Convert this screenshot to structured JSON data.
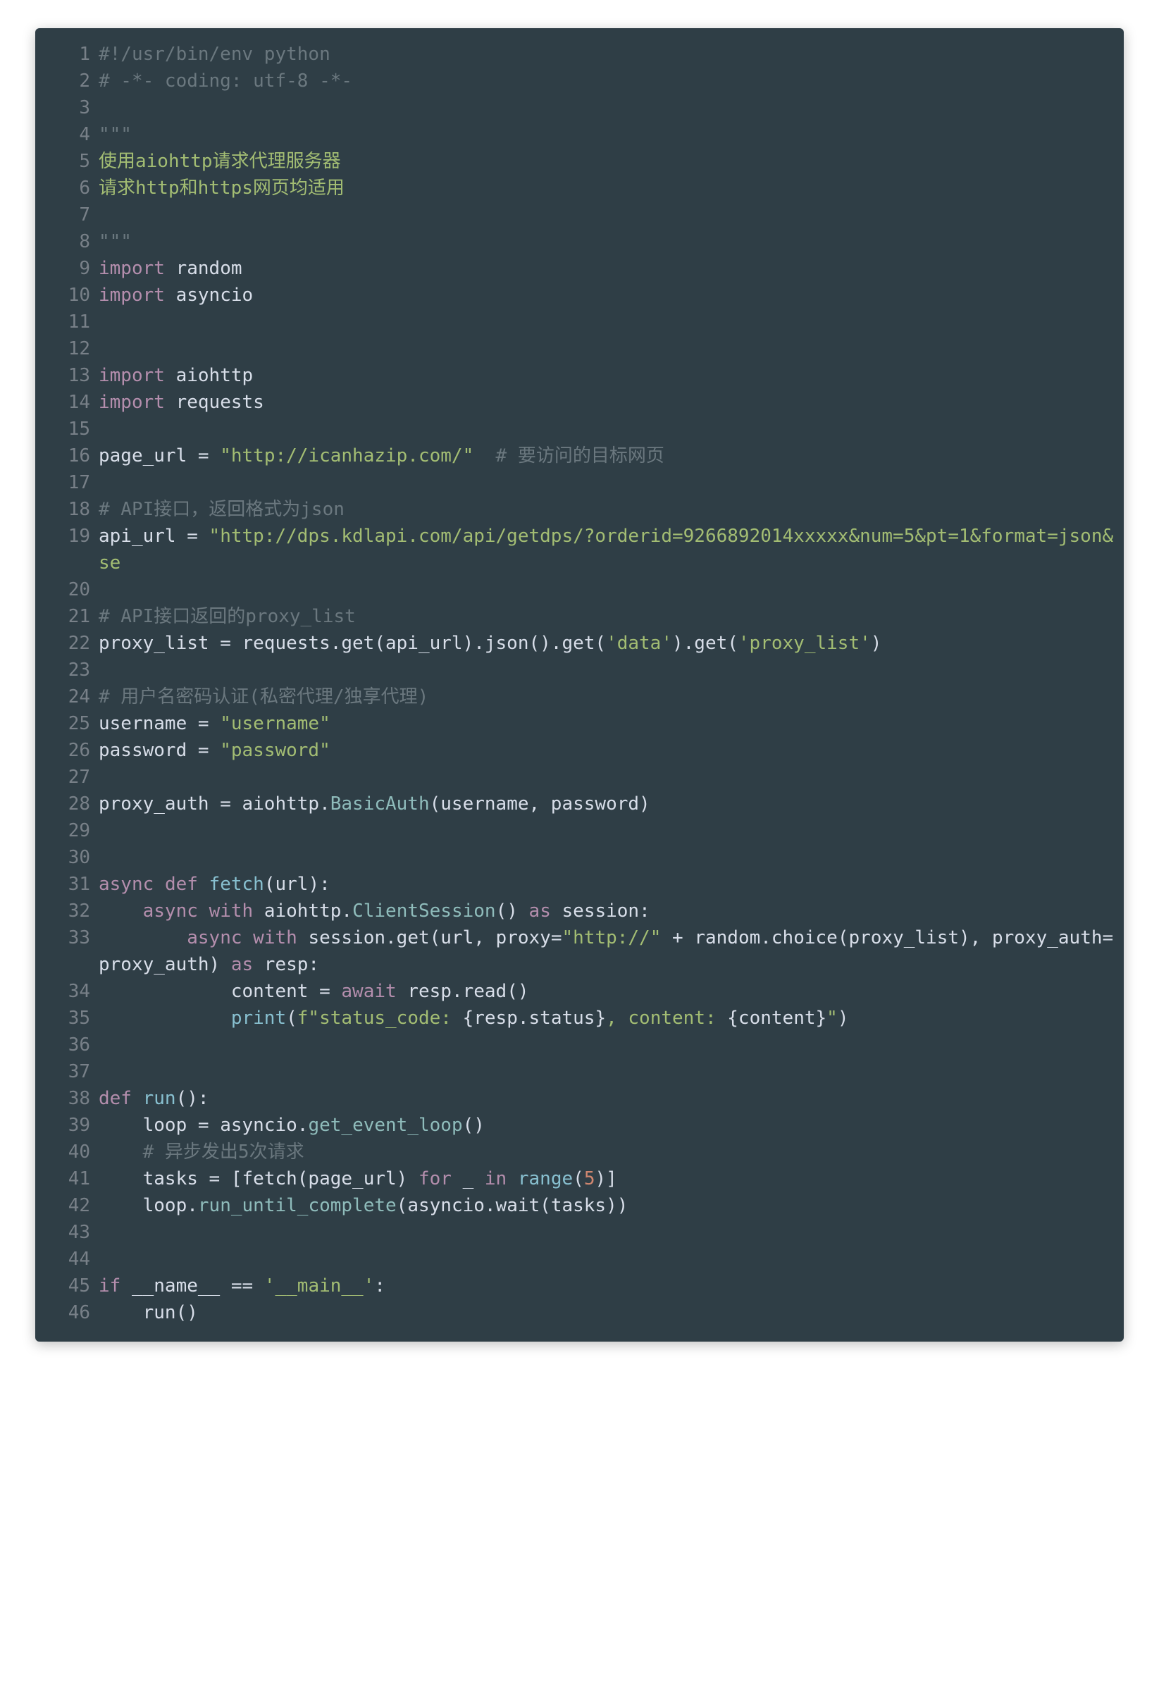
{
  "lines": [
    {
      "n": 1,
      "tokens": [
        {
          "c": "tk-comment",
          "t": "#!/usr/bin/env python"
        }
      ]
    },
    {
      "n": 2,
      "tokens": [
        {
          "c": "tk-comment",
          "t": "# -*- coding: utf-8 -*-"
        }
      ]
    },
    {
      "n": 3,
      "tokens": [
        {
          "c": "tk-plain",
          "t": ""
        }
      ]
    },
    {
      "n": 4,
      "tokens": [
        {
          "c": "tk-docstr",
          "t": "\"\"\""
        }
      ]
    },
    {
      "n": 5,
      "tokens": [
        {
          "c": "tk-doccn",
          "t": "使用aiohttp请求代理服务器"
        }
      ]
    },
    {
      "n": 6,
      "tokens": [
        {
          "c": "tk-doccn",
          "t": "请求http和https网页均适用"
        }
      ]
    },
    {
      "n": 7,
      "tokens": [
        {
          "c": "tk-plain",
          "t": ""
        }
      ]
    },
    {
      "n": 8,
      "tokens": [
        {
          "c": "tk-docstr",
          "t": "\"\"\""
        }
      ]
    },
    {
      "n": 9,
      "tokens": [
        {
          "c": "tk-keyword",
          "t": "import"
        },
        {
          "c": "tk-plain",
          "t": " random"
        }
      ]
    },
    {
      "n": 10,
      "tokens": [
        {
          "c": "tk-keyword",
          "t": "import"
        },
        {
          "c": "tk-plain",
          "t": " asyncio"
        }
      ]
    },
    {
      "n": 11,
      "tokens": [
        {
          "c": "tk-plain",
          "t": ""
        }
      ]
    },
    {
      "n": 12,
      "tokens": [
        {
          "c": "tk-plain",
          "t": ""
        }
      ]
    },
    {
      "n": 13,
      "tokens": [
        {
          "c": "tk-keyword",
          "t": "import"
        },
        {
          "c": "tk-plain",
          "t": " aiohttp"
        }
      ]
    },
    {
      "n": 14,
      "tokens": [
        {
          "c": "tk-keyword",
          "t": "import"
        },
        {
          "c": "tk-plain",
          "t": " requests"
        }
      ]
    },
    {
      "n": 15,
      "tokens": [
        {
          "c": "tk-plain",
          "t": ""
        }
      ]
    },
    {
      "n": 16,
      "tokens": [
        {
          "c": "tk-plain",
          "t": "page_url "
        },
        {
          "c": "tk-op",
          "t": "="
        },
        {
          "c": "tk-plain",
          "t": " "
        },
        {
          "c": "tk-string",
          "t": "\"http://icanhazip.com/\""
        },
        {
          "c": "tk-plain",
          "t": "  "
        },
        {
          "c": "tk-comment",
          "t": "# 要访问的目标网页"
        }
      ]
    },
    {
      "n": 17,
      "tokens": [
        {
          "c": "tk-plain",
          "t": ""
        }
      ]
    },
    {
      "n": 18,
      "tokens": [
        {
          "c": "tk-comment",
          "t": "# API接口，返回格式为json"
        }
      ]
    },
    {
      "n": 19,
      "tokens": [
        {
          "c": "tk-plain",
          "t": "api_url "
        },
        {
          "c": "tk-op",
          "t": "="
        },
        {
          "c": "tk-plain",
          "t": " "
        },
        {
          "c": "tk-string",
          "t": "\"http://dps.kdlapi.com/api/getdps/?orderid=9266892014xxxxx&num=5&pt=1&format=json&se"
        }
      ]
    },
    {
      "n": 20,
      "tokens": [
        {
          "c": "tk-plain",
          "t": ""
        }
      ]
    },
    {
      "n": 21,
      "tokens": [
        {
          "c": "tk-comment",
          "t": "# API接口返回的proxy_list"
        }
      ]
    },
    {
      "n": 22,
      "tokens": [
        {
          "c": "tk-plain",
          "t": "proxy_list "
        },
        {
          "c": "tk-op",
          "t": "="
        },
        {
          "c": "tk-plain",
          "t": " requests.get(api_url).json().get("
        },
        {
          "c": "tk-string",
          "t": "'data'"
        },
        {
          "c": "tk-plain",
          "t": ").get("
        },
        {
          "c": "tk-string",
          "t": "'proxy_list'"
        },
        {
          "c": "tk-plain",
          "t": ")"
        }
      ]
    },
    {
      "n": 23,
      "tokens": [
        {
          "c": "tk-plain",
          "t": ""
        }
      ]
    },
    {
      "n": 24,
      "tokens": [
        {
          "c": "tk-comment",
          "t": "# 用户名密码认证(私密代理/独享代理)"
        }
      ]
    },
    {
      "n": 25,
      "tokens": [
        {
          "c": "tk-plain",
          "t": "username "
        },
        {
          "c": "tk-op",
          "t": "="
        },
        {
          "c": "tk-plain",
          "t": " "
        },
        {
          "c": "tk-string",
          "t": "\"username\""
        }
      ]
    },
    {
      "n": 26,
      "tokens": [
        {
          "c": "tk-plain",
          "t": "password "
        },
        {
          "c": "tk-op",
          "t": "="
        },
        {
          "c": "tk-plain",
          "t": " "
        },
        {
          "c": "tk-string",
          "t": "\"password\""
        }
      ]
    },
    {
      "n": 27,
      "tokens": [
        {
          "c": "tk-plain",
          "t": ""
        }
      ]
    },
    {
      "n": 28,
      "tokens": [
        {
          "c": "tk-plain",
          "t": "proxy_auth "
        },
        {
          "c": "tk-op",
          "t": "="
        },
        {
          "c": "tk-plain",
          "t": " aiohttp."
        },
        {
          "c": "tk-class",
          "t": "BasicAuth"
        },
        {
          "c": "tk-plain",
          "t": "(username, password)"
        }
      ]
    },
    {
      "n": 29,
      "tokens": [
        {
          "c": "tk-plain",
          "t": ""
        }
      ]
    },
    {
      "n": 30,
      "tokens": [
        {
          "c": "tk-plain",
          "t": ""
        }
      ]
    },
    {
      "n": 31,
      "tokens": [
        {
          "c": "tk-keyword",
          "t": "async"
        },
        {
          "c": "tk-plain",
          "t": " "
        },
        {
          "c": "tk-keyword",
          "t": "def"
        },
        {
          "c": "tk-plain",
          "t": " "
        },
        {
          "c": "tk-func",
          "t": "fetch"
        },
        {
          "c": "tk-plain",
          "t": "(url):"
        }
      ]
    },
    {
      "n": 32,
      "tokens": [
        {
          "c": "tk-plain",
          "t": "    "
        },
        {
          "c": "tk-keyword",
          "t": "async"
        },
        {
          "c": "tk-plain",
          "t": " "
        },
        {
          "c": "tk-keyword",
          "t": "with"
        },
        {
          "c": "tk-plain",
          "t": " aiohttp."
        },
        {
          "c": "tk-class",
          "t": "ClientSession"
        },
        {
          "c": "tk-plain",
          "t": "() "
        },
        {
          "c": "tk-keyword",
          "t": "as"
        },
        {
          "c": "tk-plain",
          "t": " session:"
        }
      ]
    },
    {
      "n": 33,
      "tokens": [
        {
          "c": "tk-plain",
          "t": "        "
        },
        {
          "c": "tk-keyword",
          "t": "async"
        },
        {
          "c": "tk-plain",
          "t": " "
        },
        {
          "c": "tk-keyword",
          "t": "with"
        },
        {
          "c": "tk-plain",
          "t": " session.get(url, proxy="
        },
        {
          "c": "tk-string",
          "t": "\"http://\""
        },
        {
          "c": "tk-plain",
          "t": " + random.choice(proxy_list), proxy_auth=proxy_auth) "
        },
        {
          "c": "tk-keyword",
          "t": "as"
        },
        {
          "c": "tk-plain",
          "t": " resp:"
        }
      ]
    },
    {
      "n": 34,
      "tokens": [
        {
          "c": "tk-plain",
          "t": "            content "
        },
        {
          "c": "tk-op",
          "t": "="
        },
        {
          "c": "tk-plain",
          "t": " "
        },
        {
          "c": "tk-await",
          "t": "await"
        },
        {
          "c": "tk-plain",
          "t": " resp.read()"
        }
      ]
    },
    {
      "n": 35,
      "tokens": [
        {
          "c": "tk-plain",
          "t": "            "
        },
        {
          "c": "tk-func",
          "t": "print"
        },
        {
          "c": "tk-plain",
          "t": "("
        },
        {
          "c": "tk-string",
          "t": "f\"status_code: "
        },
        {
          "c": "tk-fstrtxt",
          "t": "{resp.status}"
        },
        {
          "c": "tk-string",
          "t": ", content: "
        },
        {
          "c": "tk-fstrtxt",
          "t": "{content}"
        },
        {
          "c": "tk-string",
          "t": "\""
        },
        {
          "c": "tk-plain",
          "t": ")"
        }
      ]
    },
    {
      "n": 36,
      "tokens": [
        {
          "c": "tk-plain",
          "t": ""
        }
      ]
    },
    {
      "n": 37,
      "tokens": [
        {
          "c": "tk-plain",
          "t": ""
        }
      ]
    },
    {
      "n": 38,
      "tokens": [
        {
          "c": "tk-keyword",
          "t": "def"
        },
        {
          "c": "tk-plain",
          "t": " "
        },
        {
          "c": "tk-func",
          "t": "run"
        },
        {
          "c": "tk-plain",
          "t": "():"
        }
      ]
    },
    {
      "n": 39,
      "tokens": [
        {
          "c": "tk-plain",
          "t": "    loop "
        },
        {
          "c": "tk-op",
          "t": "="
        },
        {
          "c": "tk-plain",
          "t": " asyncio."
        },
        {
          "c": "tk-class",
          "t": "get_event_loop"
        },
        {
          "c": "tk-plain",
          "t": "()"
        }
      ]
    },
    {
      "n": 40,
      "tokens": [
        {
          "c": "tk-plain",
          "t": "    "
        },
        {
          "c": "tk-comment",
          "t": "# 异步发出5次请求"
        }
      ]
    },
    {
      "n": 41,
      "tokens": [
        {
          "c": "tk-plain",
          "t": "    tasks "
        },
        {
          "c": "tk-op",
          "t": "="
        },
        {
          "c": "tk-plain",
          "t": " [fetch(page_url) "
        },
        {
          "c": "tk-keyword",
          "t": "for"
        },
        {
          "c": "tk-plain",
          "t": " _ "
        },
        {
          "c": "tk-keyword",
          "t": "in"
        },
        {
          "c": "tk-plain",
          "t": " "
        },
        {
          "c": "tk-func",
          "t": "range"
        },
        {
          "c": "tk-plain",
          "t": "("
        },
        {
          "c": "tk-number",
          "t": "5"
        },
        {
          "c": "tk-plain",
          "t": ")]"
        }
      ]
    },
    {
      "n": 42,
      "tokens": [
        {
          "c": "tk-plain",
          "t": "    loop."
        },
        {
          "c": "tk-class",
          "t": "run_until_complete"
        },
        {
          "c": "tk-plain",
          "t": "(asyncio.wait(tasks))"
        }
      ]
    },
    {
      "n": 43,
      "tokens": [
        {
          "c": "tk-plain",
          "t": ""
        }
      ]
    },
    {
      "n": 44,
      "tokens": [
        {
          "c": "tk-plain",
          "t": ""
        }
      ]
    },
    {
      "n": 45,
      "tokens": [
        {
          "c": "tk-keyword",
          "t": "if"
        },
        {
          "c": "tk-plain",
          "t": " __name__ "
        },
        {
          "c": "tk-op",
          "t": "=="
        },
        {
          "c": "tk-plain",
          "t": " "
        },
        {
          "c": "tk-string",
          "t": "'__main__'"
        },
        {
          "c": "tk-plain",
          "t": ":"
        }
      ]
    },
    {
      "n": 46,
      "tokens": [
        {
          "c": "tk-plain",
          "t": "    run()"
        }
      ]
    }
  ]
}
